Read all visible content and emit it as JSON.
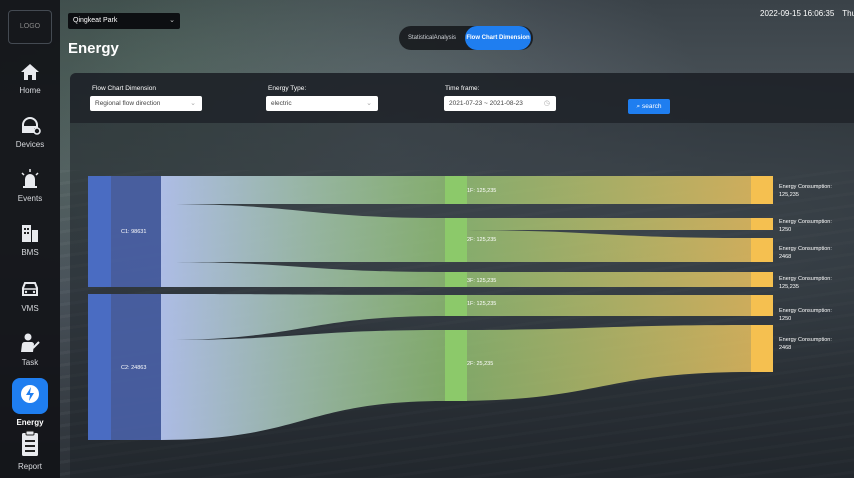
{
  "sidebar": {
    "logo": "LOGO",
    "items": [
      {
        "label": "Home",
        "icon": "home-icon"
      },
      {
        "label": "Devices",
        "icon": "devices-icon"
      },
      {
        "label": "Events",
        "icon": "events-icon"
      },
      {
        "label": "BMS",
        "icon": "bms-icon"
      },
      {
        "label": "VMS",
        "icon": "vms-icon"
      },
      {
        "label": "Task",
        "icon": "task-icon"
      },
      {
        "label": "Energy",
        "icon": "energy-icon",
        "active": true
      },
      {
        "label": "Report",
        "icon": "report-icon"
      }
    ],
    "active_color": "#1f7ef0"
  },
  "header": {
    "park": "Qingkeat Park",
    "title": "Energy",
    "tabs": [
      {
        "label": "StatisticalAnalysis",
        "active": false
      },
      {
        "label": "Flow Chart Dimension",
        "active": true
      }
    ],
    "datetime": "2022-09-15 16:06:35",
    "weekday": "Thu"
  },
  "filters": {
    "dimension_label": "Flow Chart Dimension",
    "dimension_value": "Regional flow direction",
    "energy_label": "Energy Type:",
    "energy_value": "electric",
    "time_label": "Time frame:",
    "time_value": "2021-07-23 ~ 2021-08-23",
    "search_label": "search"
  },
  "sankey": {
    "colors": {
      "source": "#4a6cc2",
      "source_band": "#4a62a8",
      "middle": "#8cc96a",
      "target": "#f5c050"
    },
    "sources": [
      {
        "label": "C1: 98631"
      },
      {
        "label": "C2: 24863"
      }
    ],
    "middles": [
      {
        "label": "1F: 125,235"
      },
      {
        "label": "2F: 125,235"
      },
      {
        "label": "3F: 125,235"
      },
      {
        "label": "1F: 125,235"
      },
      {
        "label": "2F: 25,235"
      }
    ],
    "targets": [
      {
        "title": "Energy Consumption:",
        "value": "125,235"
      },
      {
        "title": "Energy Consumption:",
        "value": "1250"
      },
      {
        "title": "Energy Consumption:",
        "value": "2468"
      },
      {
        "title": "Energy Consumption:",
        "value": "125,235"
      },
      {
        "title": "Energy Consumption:",
        "value": "1250"
      },
      {
        "title": "Energy Consumption:",
        "value": "2468"
      }
    ]
  }
}
